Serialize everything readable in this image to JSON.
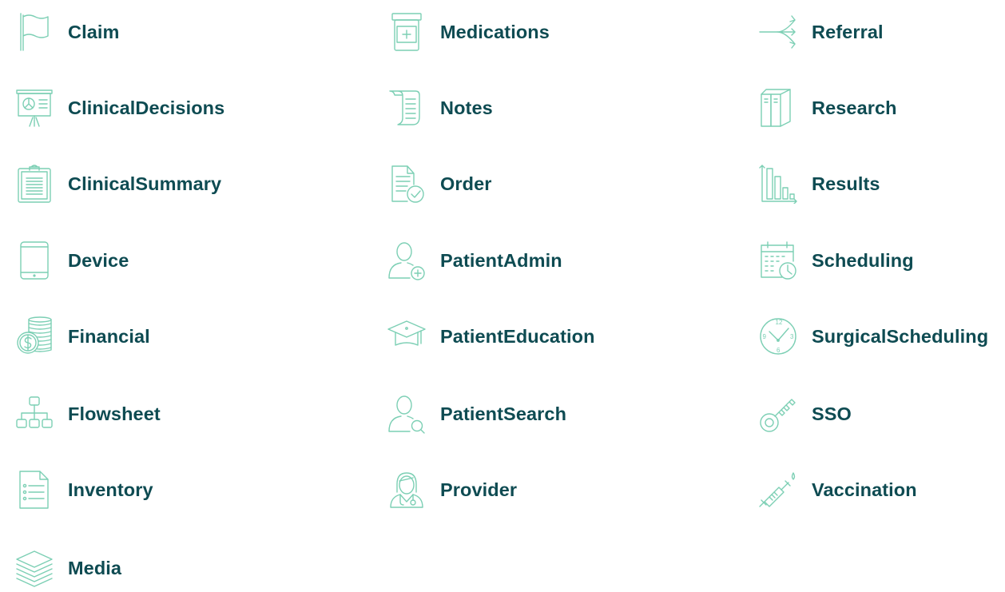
{
  "colors": {
    "icon_stroke": "#7ccfb4",
    "label_text": "#0e4b52",
    "background": "#ffffff"
  },
  "columns": [
    {
      "items": [
        {
          "icon": "flag-icon",
          "label": "Claim"
        },
        {
          "icon": "presentation-chart-icon",
          "label": "ClinicalDecisions"
        },
        {
          "icon": "clipboard-icon",
          "label": "ClinicalSummary"
        },
        {
          "icon": "tablet-device-icon",
          "label": "Device"
        },
        {
          "icon": "coin-stack-icon",
          "label": "Financial"
        },
        {
          "icon": "hierarchy-tree-icon",
          "label": "Flowsheet"
        },
        {
          "icon": "checklist-document-icon",
          "label": "Inventory"
        },
        {
          "icon": "layers-stack-icon",
          "label": "Media"
        }
      ]
    },
    {
      "items": [
        {
          "icon": "pill-bottle-icon",
          "label": "Medications"
        },
        {
          "icon": "scroll-notes-icon",
          "label": "Notes"
        },
        {
          "icon": "document-check-icon",
          "label": "Order"
        },
        {
          "icon": "user-add-icon",
          "label": "PatientAdmin"
        },
        {
          "icon": "graduation-cap-icon",
          "label": "PatientEducation"
        },
        {
          "icon": "user-search-icon",
          "label": "PatientSearch"
        },
        {
          "icon": "doctor-stethoscope-icon",
          "label": "Provider"
        }
      ]
    },
    {
      "items": [
        {
          "icon": "branching-arrows-icon",
          "label": "Referral"
        },
        {
          "icon": "binders-icon",
          "label": "Research"
        },
        {
          "icon": "bar-chart-icon",
          "label": "Results"
        },
        {
          "icon": "calendar-clock-icon",
          "label": "Scheduling"
        },
        {
          "icon": "clock-face-icon",
          "label": "SurgicalScheduling",
          "clock_numbers": [
            "12",
            "3",
            "6",
            "9"
          ]
        },
        {
          "icon": "key-icon",
          "label": "SSO"
        },
        {
          "icon": "syringe-icon",
          "label": "Vaccination"
        }
      ]
    }
  ]
}
